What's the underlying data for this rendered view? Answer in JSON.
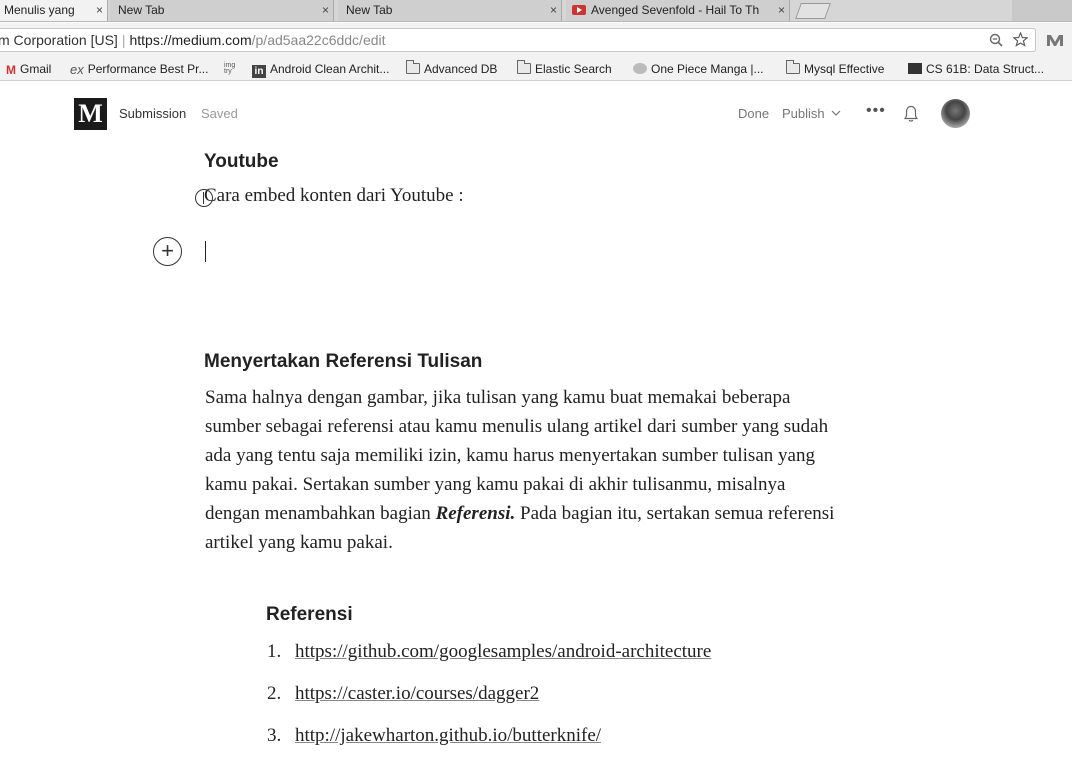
{
  "browser": {
    "tabs": [
      {
        "title": "Menulis yang",
        "active": true
      },
      {
        "title": "New Tab",
        "active": false
      },
      {
        "title": "New Tab",
        "active": false
      },
      {
        "title": "Avenged Sevenfold - Hail To Th",
        "active": false
      }
    ],
    "tab_close_glyph": "×",
    "address": {
      "ev_label": "m Corporation [US]",
      "url_host": "https://medium.com",
      "url_path": "/p/ad5aa22c6ddc/edit"
    },
    "bookmarks": [
      {
        "label": "Gmail",
        "icon": "gmail-icon"
      },
      {
        "label": "Performance Best Pr...",
        "icon": "ex-icon"
      },
      {
        "label": "",
        "icon": "img-icon"
      },
      {
        "label": "Android Clean Archit...",
        "icon": "linkedin-icon"
      },
      {
        "label": "Advanced DB",
        "icon": "folder-icon"
      },
      {
        "label": "Elastic Search",
        "icon": "folder-icon"
      },
      {
        "label": "One Piece Manga |...",
        "icon": "site-icon"
      },
      {
        "label": "Mysql Effective",
        "icon": "folder-icon"
      },
      {
        "label": "CS 61B: Data Struct...",
        "icon": "cs61b-icon"
      }
    ]
  },
  "medium_header": {
    "logo": "M",
    "submission": "Submission",
    "saved": "Saved",
    "done": "Done",
    "publish": "Publish",
    "more": "•••"
  },
  "article": {
    "youtube_heading": "Youtube",
    "youtube_line": "Cara embed konten dari Youtube :",
    "plus_glyph": "+",
    "reference_heading": "Menyertakan Referensi Tulisan",
    "paragraph_before": "Sama halnya dengan gambar, jika tulisan yang kamu buat memakai beberapa sumber sebagai referensi atau kamu menulis ulang artikel dari sumber yang sudah ada yang tentu saja memiliki izin, kamu harus menyertakan sumber tulisan yang kamu pakai. Sertakan sumber yang kamu pakai di akhir tulisanmu, misalnya dengan menambahkan bagian ",
    "paragraph_term": "Referensi.",
    "paragraph_after": " Pada bagian itu, sertakan semua referensi artikel yang kamu pakai.",
    "references_subheading": "Referensi",
    "references": [
      {
        "num": "1.",
        "url": "https://github.com/googlesamples/android-architecture"
      },
      {
        "num": "2.",
        "url": "https://caster.io/courses/dagger2"
      },
      {
        "num": "3.",
        "url": "http://jakewharton.github.io/butterknife/"
      }
    ]
  }
}
